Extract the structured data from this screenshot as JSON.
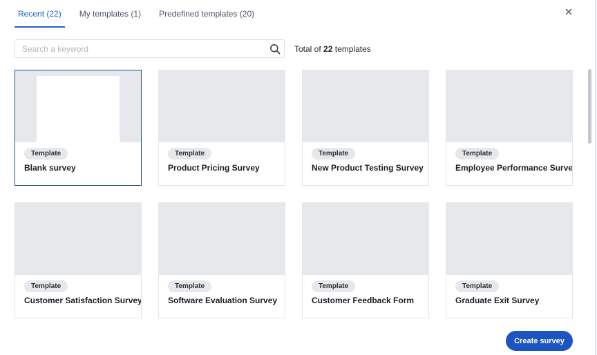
{
  "tabs": [
    {
      "label": "Recent (22)",
      "active": true
    },
    {
      "label": "My templates (1)",
      "active": false
    },
    {
      "label": "Predefined templates (20)",
      "active": false
    }
  ],
  "search": {
    "placeholder": "Search a keyword",
    "value": ""
  },
  "total": {
    "prefix": "Total of",
    "count": "22",
    "suffix": "templates"
  },
  "cards": [
    {
      "badge": "Template",
      "title": "Blank survey",
      "selected": true
    },
    {
      "badge": "Template",
      "title": "Product Pricing Survey"
    },
    {
      "badge": "Template",
      "title": "New Product Testing Survey"
    },
    {
      "badge": "Template",
      "title": "Employee Performance Survey"
    },
    {
      "badge": "Template",
      "title": "Customer Satisfaction Survey"
    },
    {
      "badge": "Template",
      "title": "Software Evaluation Survey"
    },
    {
      "badge": "Template",
      "title": "Customer Feedback Form"
    },
    {
      "badge": "Template",
      "title": "Graduate Exit Survey"
    }
  ],
  "actions": {
    "create_label": "Create survey"
  },
  "colors": {
    "accent": "#1f5fbf",
    "primary_button": "#1c55c2",
    "thumbnail": "#e6e8eb",
    "selected_border": "#1f4f91"
  },
  "icons": {
    "close": "close-icon",
    "search": "search-icon"
  }
}
